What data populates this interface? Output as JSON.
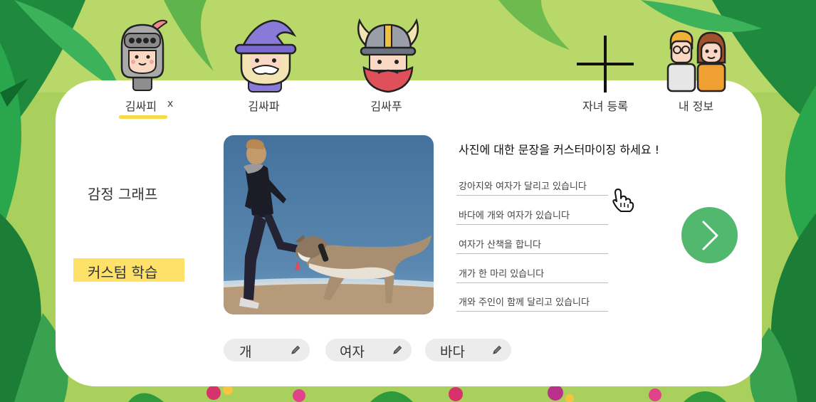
{
  "profiles": [
    {
      "name": "김싸피",
      "icon": "knight-avatar-icon",
      "selected": true,
      "close": "x"
    },
    {
      "name": "김싸파",
      "icon": "wizard-avatar-icon",
      "selected": false
    },
    {
      "name": "김싸푸",
      "icon": "viking-avatar-icon",
      "selected": false
    }
  ],
  "header": {
    "register_label": "자녀 등록",
    "register_icon": "plus-icon",
    "myinfo_label": "내 정보",
    "myinfo_icon": "parents-icon"
  },
  "sidebar": {
    "items": [
      {
        "label": "감정 그래프",
        "active": false
      },
      {
        "label": "커스텀 학습",
        "active": true
      }
    ]
  },
  "main": {
    "photo_icon": "woman-running-with-dog-photo",
    "question": "사진에 대한 문장을 커스터마이징 하세요 !",
    "sentences": [
      "강아지와 여자가 달리고 있습니다",
      "바다에 개와 여자가 있습니다",
      "여자가 산책을 합니다",
      "개가 한 마리 있습니다",
      "개와 주인이 함께 달리고 있습니다"
    ],
    "next_icon": "chevron-right-icon",
    "tags": [
      "개",
      "여자",
      "바다"
    ],
    "tag_edit_icon": "pencil-icon"
  },
  "colors": {
    "accent_yellow": "#fde168",
    "underline_yellow": "#f7d94a",
    "next_green": "#52b86e",
    "jungle_green": "#2e9a3c"
  }
}
